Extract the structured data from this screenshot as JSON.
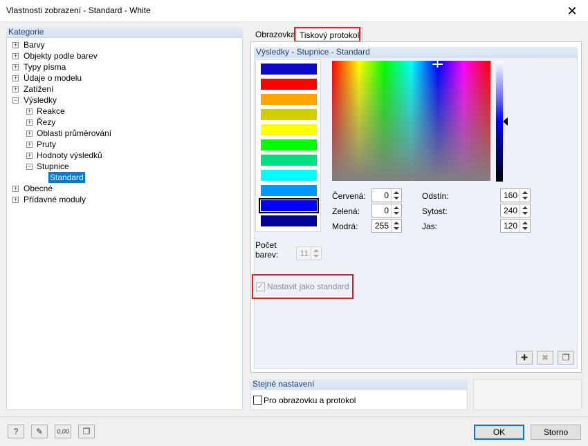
{
  "window": {
    "title": "Vlastnosti zobrazení - Standard - White",
    "close_glyph": "✕"
  },
  "sidebar": {
    "header": "Kategorie",
    "items": [
      {
        "label": "Barvy",
        "expander": "+"
      },
      {
        "label": "Objekty podle barev",
        "expander": "+"
      },
      {
        "label": "Typy písma",
        "expander": "+"
      },
      {
        "label": "Údaje o modelu",
        "expander": "+"
      },
      {
        "label": "Zatížení",
        "expander": "+"
      },
      {
        "label": "Výsledky",
        "expander": "−"
      },
      {
        "label": "Reakce",
        "expander": "+"
      },
      {
        "label": "Řezy",
        "expander": "+"
      },
      {
        "label": "Oblasti průměrování",
        "expander": "+"
      },
      {
        "label": "Pruty",
        "expander": "+"
      },
      {
        "label": "Hodnoty výsledků",
        "expander": "+"
      },
      {
        "label": "Stupnice",
        "expander": "−"
      },
      {
        "label": "Standard",
        "selected": true
      },
      {
        "label": "Obecné",
        "expander": "+"
      },
      {
        "label": "Přídavné moduly",
        "expander": "+"
      }
    ]
  },
  "tabs": [
    {
      "label": "Obrazovka"
    },
    {
      "label": "Tiskový protokol",
      "active": true
    }
  ],
  "results_group": {
    "header": "Výsledky - Stupnice - Standard",
    "swatch_colors": [
      "#0a0ac8",
      "#ff0000",
      "#ffa500",
      "#d0d000",
      "#ffff00",
      "#00ff00",
      "#00e080",
      "#00ffff",
      "#0096ff",
      "#0000ff",
      "#000096"
    ],
    "selected_swatch": 9,
    "count_label": "Počet barev:",
    "count_value": "11",
    "rgb": [
      {
        "label": "Červená:",
        "value": "0"
      },
      {
        "label": "Zelená:",
        "value": "0"
      },
      {
        "label": "Modrá:",
        "value": "255"
      }
    ],
    "hsl": [
      {
        "label": "Odstín:",
        "value": "160"
      },
      {
        "label": "Sytost:",
        "value": "240"
      },
      {
        "label": "Jas:",
        "value": "120"
      }
    ],
    "default_checkbox": {
      "label": "Nastavit jako standard",
      "checked": true,
      "disabled": true
    },
    "icon_buttons": [
      {
        "icon": "new-scale-icon",
        "glyph": "✚"
      },
      {
        "icon": "delete-icon",
        "glyph": "✖"
      },
      {
        "icon": "copy-icon",
        "glyph": "❐"
      }
    ]
  },
  "same_settings": {
    "header": "Stejné nastavení",
    "checkbox_label": "Pro obrazovku a protokol",
    "checked": false
  },
  "footer": {
    "icon_buttons": [
      {
        "icon": "help-icon",
        "glyph": "?"
      },
      {
        "icon": "edit-icon",
        "glyph": "✎"
      },
      {
        "icon": "units-icon",
        "glyph": "0,00"
      },
      {
        "icon": "copy-settings-icon",
        "glyph": "❐"
      }
    ],
    "ok_label": "OK",
    "cancel_label": "Storno"
  },
  "colors": {
    "accent": "#0078d7",
    "highlight": "#e02020",
    "header_text": "#1f3f6e"
  }
}
